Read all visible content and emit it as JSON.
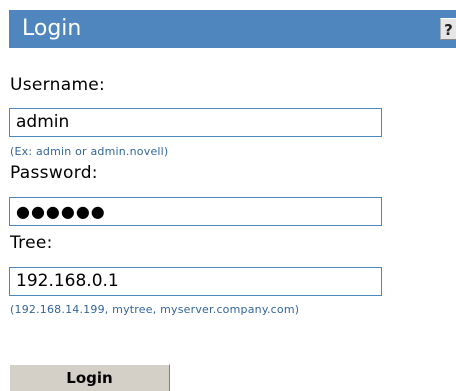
{
  "header": {
    "title": "Login",
    "help_label": "?"
  },
  "form": {
    "username": {
      "label": "Username:",
      "value": "admin",
      "hint": "(Ex: admin or admin.novell)"
    },
    "password": {
      "label": "Password:",
      "value": "●●●●●●"
    },
    "tree": {
      "label": "Tree:",
      "value": "192.168.0.1",
      "hint": "(192.168.14.199, mytree, myserver.company.com)"
    },
    "login_label": "Login"
  },
  "colors": {
    "header_background": "#4f86bd",
    "field_border": "#4f86bd",
    "hint_text": "#336699",
    "button_face": "#d4d0c8"
  }
}
